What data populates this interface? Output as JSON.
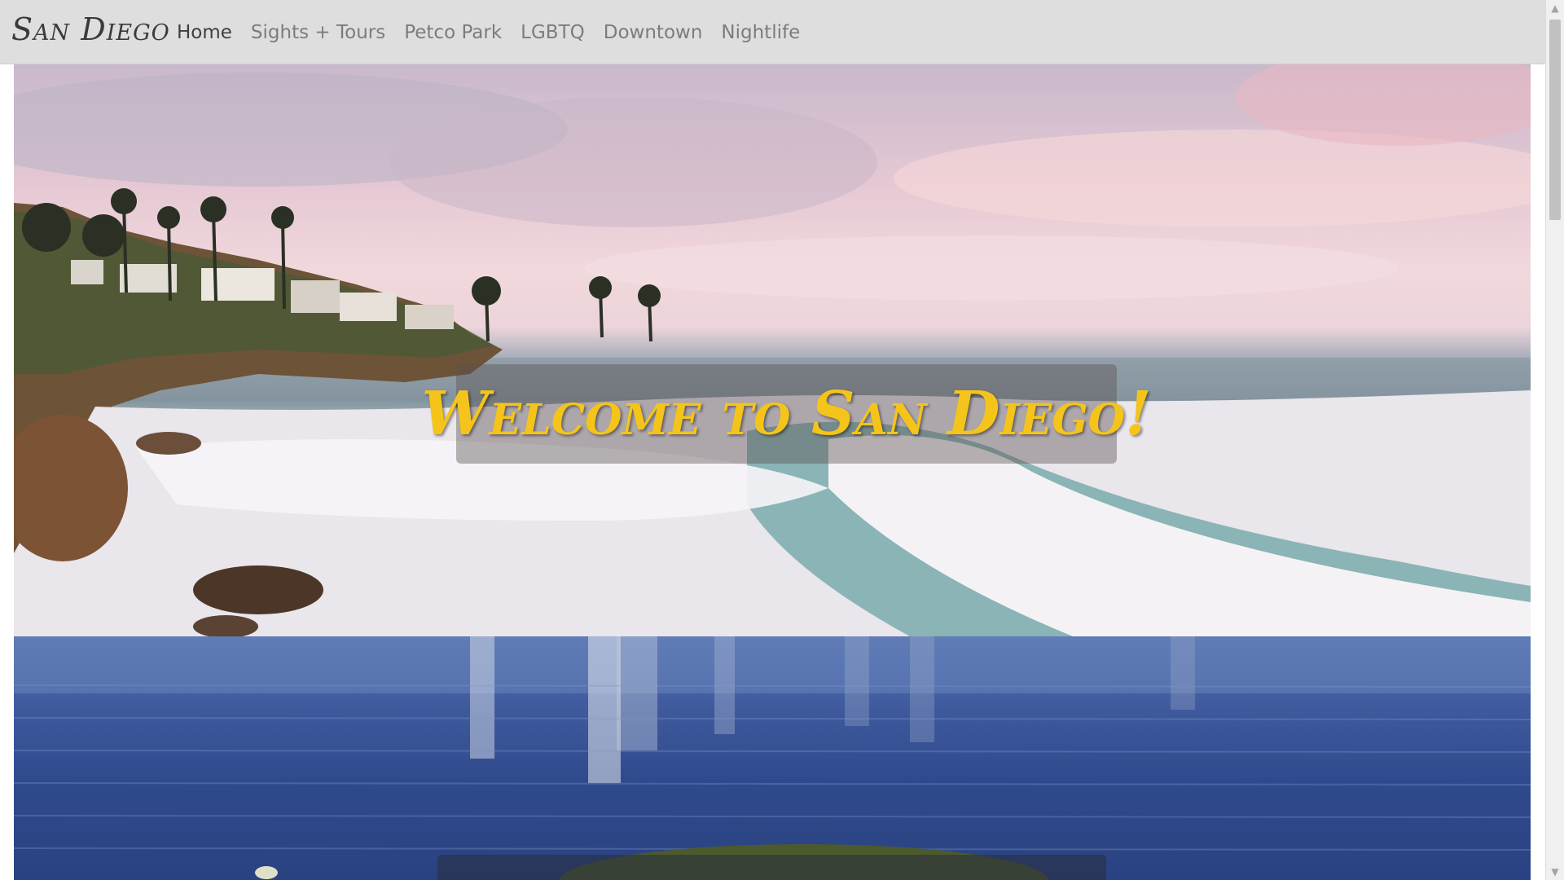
{
  "navbar": {
    "brand": "San Diego",
    "links": [
      {
        "label": "Home",
        "active": true
      },
      {
        "label": "Sights + Tours",
        "active": false
      },
      {
        "label": "Petco Park",
        "active": false
      },
      {
        "label": "LGBTQ",
        "active": false
      },
      {
        "label": "Downtown",
        "active": false
      },
      {
        "label": "Nightlife",
        "active": false
      }
    ]
  },
  "hero": {
    "heading": "Welcome to San Diego!"
  },
  "colors": {
    "navbar_bg": "#dedede",
    "heading_yellow": "#f5c41b",
    "active_link": "#3f3f3f",
    "link": "#7c7c7c"
  },
  "scrollbar": {
    "up_icon": "chevron-up-icon",
    "down_icon": "chevron-down-icon"
  }
}
